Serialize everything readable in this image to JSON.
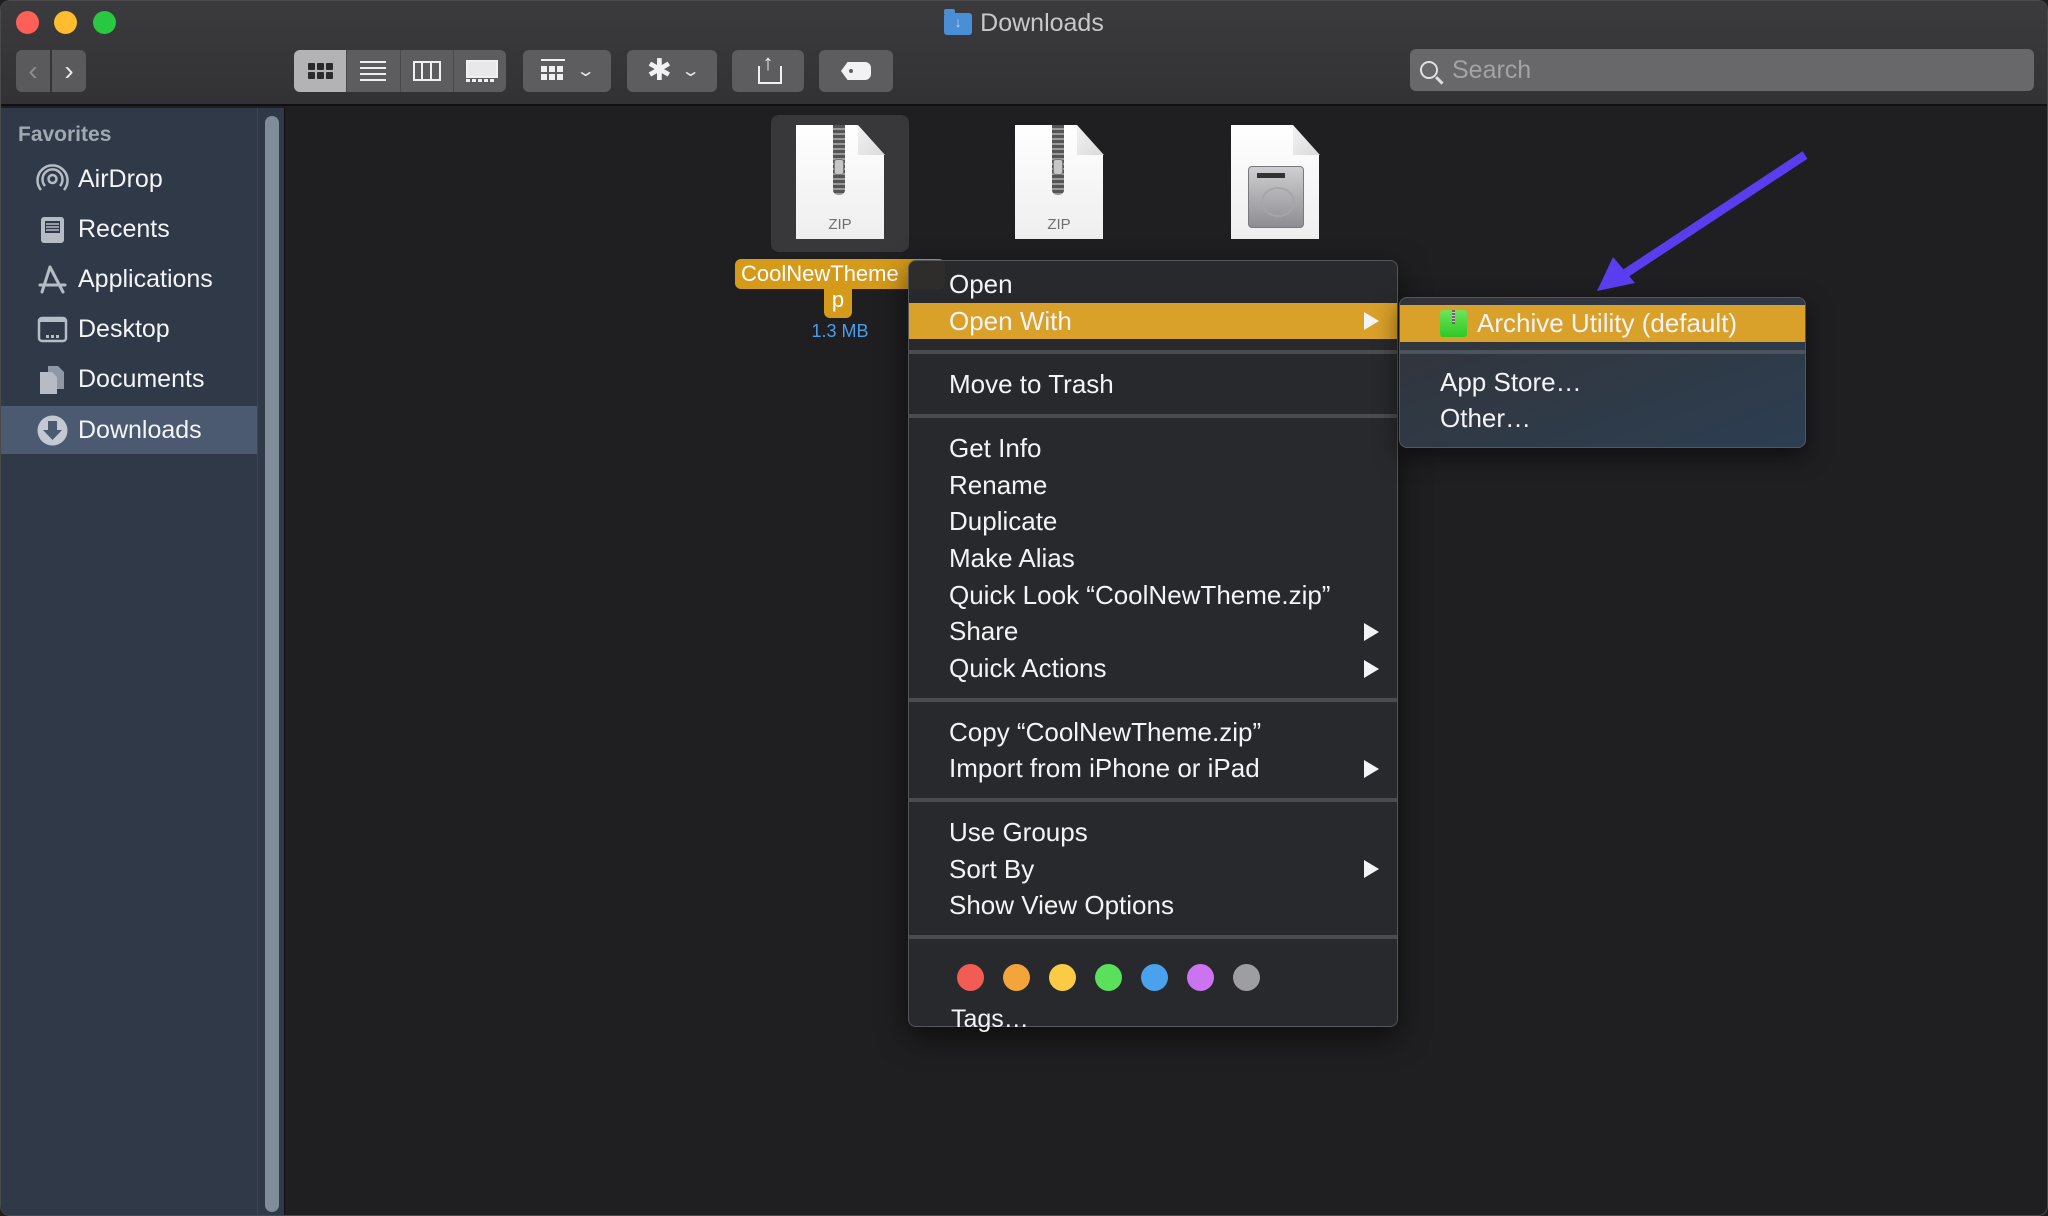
{
  "window": {
    "title": "Downloads",
    "traffic_lights": [
      "close",
      "minimize",
      "zoom"
    ]
  },
  "toolbar": {
    "back_icon": "chevron-left-icon",
    "forward_icon": "chevron-right-icon",
    "view_modes": [
      "icon-view",
      "list-view",
      "column-view",
      "gallery-view"
    ],
    "active_view": "icon-view",
    "group_icon": "group-by-icon",
    "action_icon": "gear-icon",
    "share_icon": "share-icon",
    "tag_icon": "tag-icon",
    "chevron": "⌄",
    "back_glyph": "‹",
    "forward_glyph": "›",
    "gear_glyph": "✱",
    "search_placeholder": "Search"
  },
  "sidebar": {
    "section_label": "Favorites",
    "items": [
      {
        "label": "AirDrop",
        "icon": "airdrop-icon",
        "active": false
      },
      {
        "label": "Recents",
        "icon": "recents-icon",
        "active": false
      },
      {
        "label": "Applications",
        "icon": "applications-icon",
        "active": false
      },
      {
        "label": "Desktop",
        "icon": "desktop-icon",
        "active": false
      },
      {
        "label": "Documents",
        "icon": "documents-icon",
        "active": false
      },
      {
        "label": "Downloads",
        "icon": "downloads-icon",
        "active": true
      }
    ]
  },
  "files": [
    {
      "name": "CoolNewTheme.zip",
      "name_line1": "CoolNewTheme",
      "name_line2": "p",
      "type_label": "ZIP",
      "size": "1.3 MB",
      "selected": true,
      "icon": "zip-file-icon"
    },
    {
      "name": "",
      "type_label": "ZIP",
      "selected": false,
      "icon": "zip-file-icon"
    },
    {
      "name": "",
      "type_label": "",
      "selected": false,
      "icon": "disk-image-icon"
    }
  ],
  "context_menu": {
    "groups": [
      [
        {
          "label": "Open",
          "submenu": false,
          "highlighted": false
        },
        {
          "label": "Open With",
          "submenu": true,
          "highlighted": true
        }
      ],
      [
        {
          "label": "Move to Trash",
          "submenu": false
        }
      ],
      [
        {
          "label": "Get Info",
          "submenu": false
        },
        {
          "label": "Rename",
          "submenu": false
        },
        {
          "label": "Duplicate",
          "submenu": false
        },
        {
          "label": "Make Alias",
          "submenu": false
        },
        {
          "label": "Quick Look “CoolNewTheme.zip”",
          "submenu": false
        },
        {
          "label": "Share",
          "submenu": true
        },
        {
          "label": "Quick Actions",
          "submenu": true
        }
      ],
      [
        {
          "label": "Copy “CoolNewTheme.zip”",
          "submenu": false
        },
        {
          "label": "Import from iPhone or iPad",
          "submenu": true
        }
      ],
      [
        {
          "label": "Use Groups",
          "submenu": false
        },
        {
          "label": "Sort By",
          "submenu": true
        },
        {
          "label": "Show View Options",
          "submenu": false
        }
      ]
    ],
    "tag_colors": [
      {
        "name": "red",
        "color": "#f25c54"
      },
      {
        "name": "orange",
        "color": "#f3a43b"
      },
      {
        "name": "yellow",
        "color": "#fccb45"
      },
      {
        "name": "green",
        "color": "#5ae05a"
      },
      {
        "name": "blue",
        "color": "#4aa1ee"
      },
      {
        "name": "purple",
        "color": "#cc73f2"
      },
      {
        "name": "gray",
        "color": "#9e9ea2"
      }
    ],
    "tags_label": "Tags…"
  },
  "open_with_submenu": {
    "items": [
      {
        "label": "Archive Utility (default)",
        "icon": "archive-utility-icon",
        "highlighted": true
      },
      {
        "label": "App Store…"
      },
      {
        "label": "Other…"
      }
    ]
  },
  "annotation": {
    "type": "arrow",
    "color": "#5b3df0",
    "points_to": "Archive Utility (default)"
  },
  "colors": {
    "highlight": "#d9a02a",
    "selection_label": "#d59a1a",
    "file_size_text": "#4a9ee8",
    "sidebar_bg": "#2f3948"
  }
}
